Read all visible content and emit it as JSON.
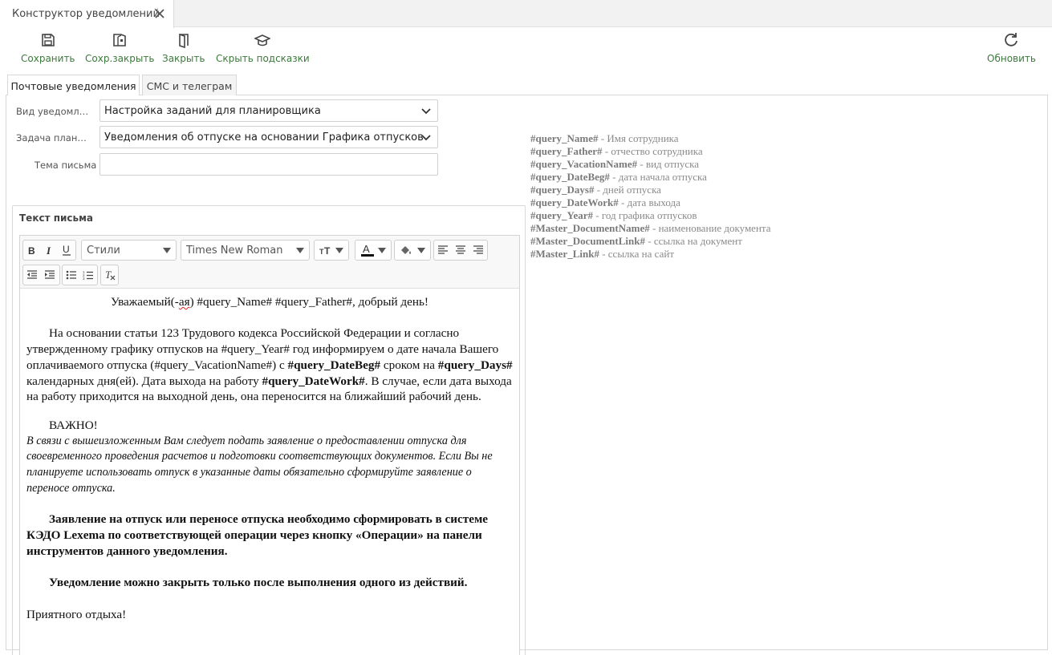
{
  "window": {
    "tab_title": "Конструктор уведомлений",
    "close_icon": "close-icon"
  },
  "toolbar": {
    "save": "Сохранить",
    "save_close": "Сохр.закрыть",
    "close": "Закрыть",
    "hide_hints": "Скрыть подсказки",
    "refresh": "Обновить",
    "accent_color": "#3b7a3b"
  },
  "tabs": [
    {
      "label": "Почтовые уведомления",
      "active": true
    },
    {
      "label": "СМС и телеграм",
      "active": false
    }
  ],
  "form": {
    "type_label": "Вид уведомления",
    "type_value": "Настройка заданий для планировщика",
    "task_label": "Задача планировщика",
    "task_value": "Уведомления об отпуске на основании Графика отпусков",
    "subject_label": "Тема письма",
    "subject_value": ""
  },
  "body_section": {
    "title": "Текст письма",
    "editor": {
      "styles_placeholder": "Стили",
      "font_value": "Times New Roman",
      "font_color": "#111111",
      "content": {
        "greeting_a": "Уважаемый(-",
        "greeting_squiggle": "ая",
        "greeting_b": ") #query_Name# #query_Father#, добрый день!",
        "p1_a": "На основании статьи 123 Трудового кодекса Российской Федерации и согласно утвержденному графику отпусков на #query_Year# год информируем о дате начала Вашего оплачиваемого отпуска (#query_VacationName#) с ",
        "p1_b": "#query_DateBeg#",
        "p1_c": "  сроком на ",
        "p1_d": "#query_Days#",
        "p1_e": " календарных дня(ей). Дата выхода на работу ",
        "p1_f": "#query_DateWork#",
        "p1_g": ". В случае, если дата выхода на работу приходится на выходной день, она переносится на ближайший рабочий день.",
        "important": "ВАЖНО!",
        "italic": "В связи с вышеизложенным Вам следует подать заявление о предоставлении отпуска для своевременного проведения расчетов и подготовки соответствующих документов. Если Вы не планируете использовать отпуск в указанные даты обязательно сформируйте заявление о переносе отпуска.",
        "bold1": "Заявление на отпуск или переносе отпуска необходимо сформировать в системе КЭДО Lexema по соответствующей операции через кнопку «Операции» на панели инструментов данного уведомления.",
        "bold2": "Уведомление можно закрыть только после выполнения одного из действий.",
        "closing": "Приятного отдыха!"
      }
    }
  },
  "hints": [
    {
      "key": "#query_Name#",
      "desc": " - Имя сотрудника"
    },
    {
      "key": "#query_Father#",
      "desc": " - отчество сотрудника"
    },
    {
      "key": "#query_VacationName#",
      "desc": " - вид отпуска"
    },
    {
      "key": "#query_DateBeg#",
      "desc": " - дата начала отпуска"
    },
    {
      "key": "#query_Days#",
      "desc": " - дней отпуска"
    },
    {
      "key": "#query_DateWork#",
      "desc": " - дата выхода"
    },
    {
      "key": "#query_Year#",
      "desc": " - год графика отпусков"
    },
    {
      "key": "#Master_DocumentName#",
      "desc": " - наименование документа"
    },
    {
      "key": "#Master_DocumentLink#",
      "desc": " - ссылка на документ"
    },
    {
      "key": "#Master_Link#",
      "desc": " - ссылка на сайт"
    }
  ]
}
